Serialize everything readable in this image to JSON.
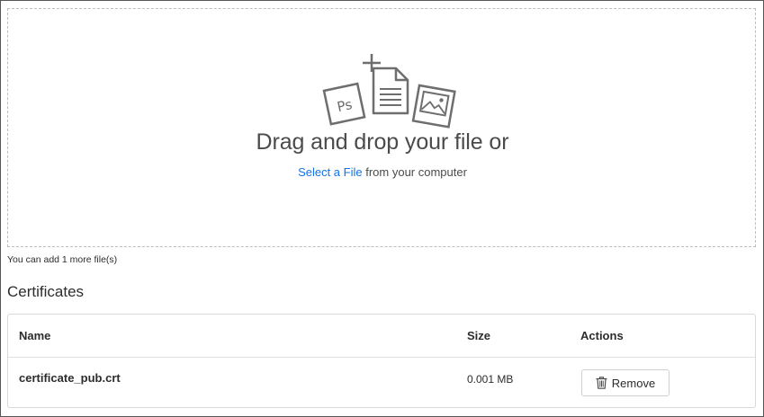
{
  "dropzone": {
    "title": "Drag and drop your file or",
    "link_label": "Select a File",
    "suffix": " from your computer",
    "icons": [
      "photoshop-file-icon",
      "add-document-icon",
      "image-file-icon"
    ]
  },
  "limit_note": "You can add 1 more file(s)",
  "certificates": {
    "title": "Certificates",
    "columns": {
      "name": "Name",
      "size": "Size",
      "actions": "Actions"
    },
    "rows": [
      {
        "name": "certificate_pub.crt",
        "size": "0.001 MB",
        "action_label": "Remove"
      }
    ]
  },
  "colors": {
    "link": "#1473e6",
    "text": "#2c2c2c",
    "border": "#d9d9d9",
    "dash": "#bdbdbd"
  }
}
